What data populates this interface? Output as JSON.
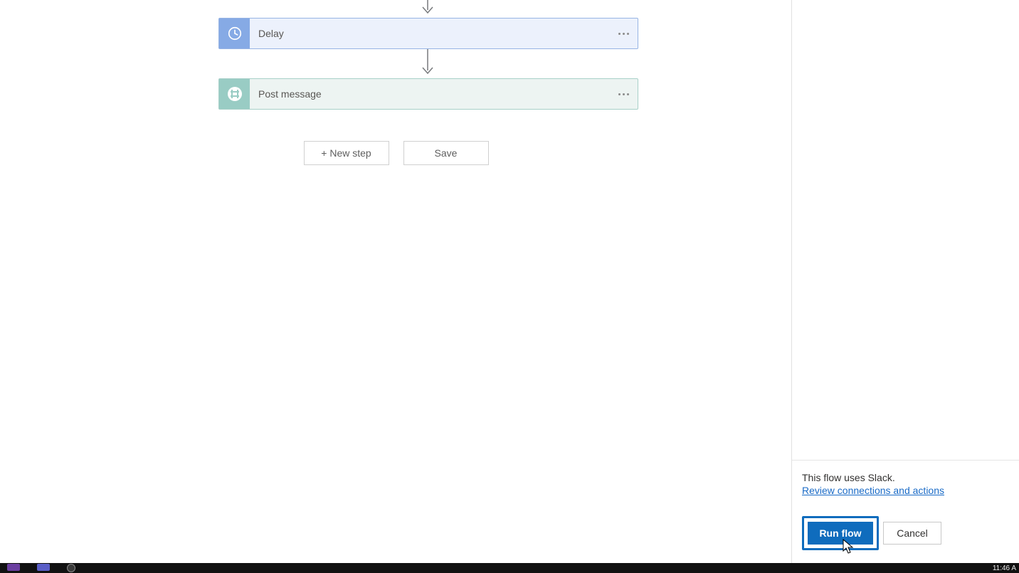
{
  "flow": {
    "cards": {
      "delay": {
        "label": "Delay",
        "icon": "clock-icon"
      },
      "post": {
        "label": "Post message",
        "icon": "slack-hash-icon"
      }
    }
  },
  "buttons": {
    "new_step": "+ New step",
    "save": "Save"
  },
  "panel": {
    "uses_text": "This flow uses Slack.",
    "review_link": "Review connections and actions",
    "run_label": "Run flow",
    "cancel_label": "Cancel"
  },
  "taskbar": {
    "clock": "11:46 A"
  },
  "colors": {
    "accent": "#0f6cbd",
    "delay_bg": "#ecf1fc",
    "delay_icon": "#86aae5",
    "post_bg": "#edf4f2",
    "post_icon": "#99ccc4"
  }
}
